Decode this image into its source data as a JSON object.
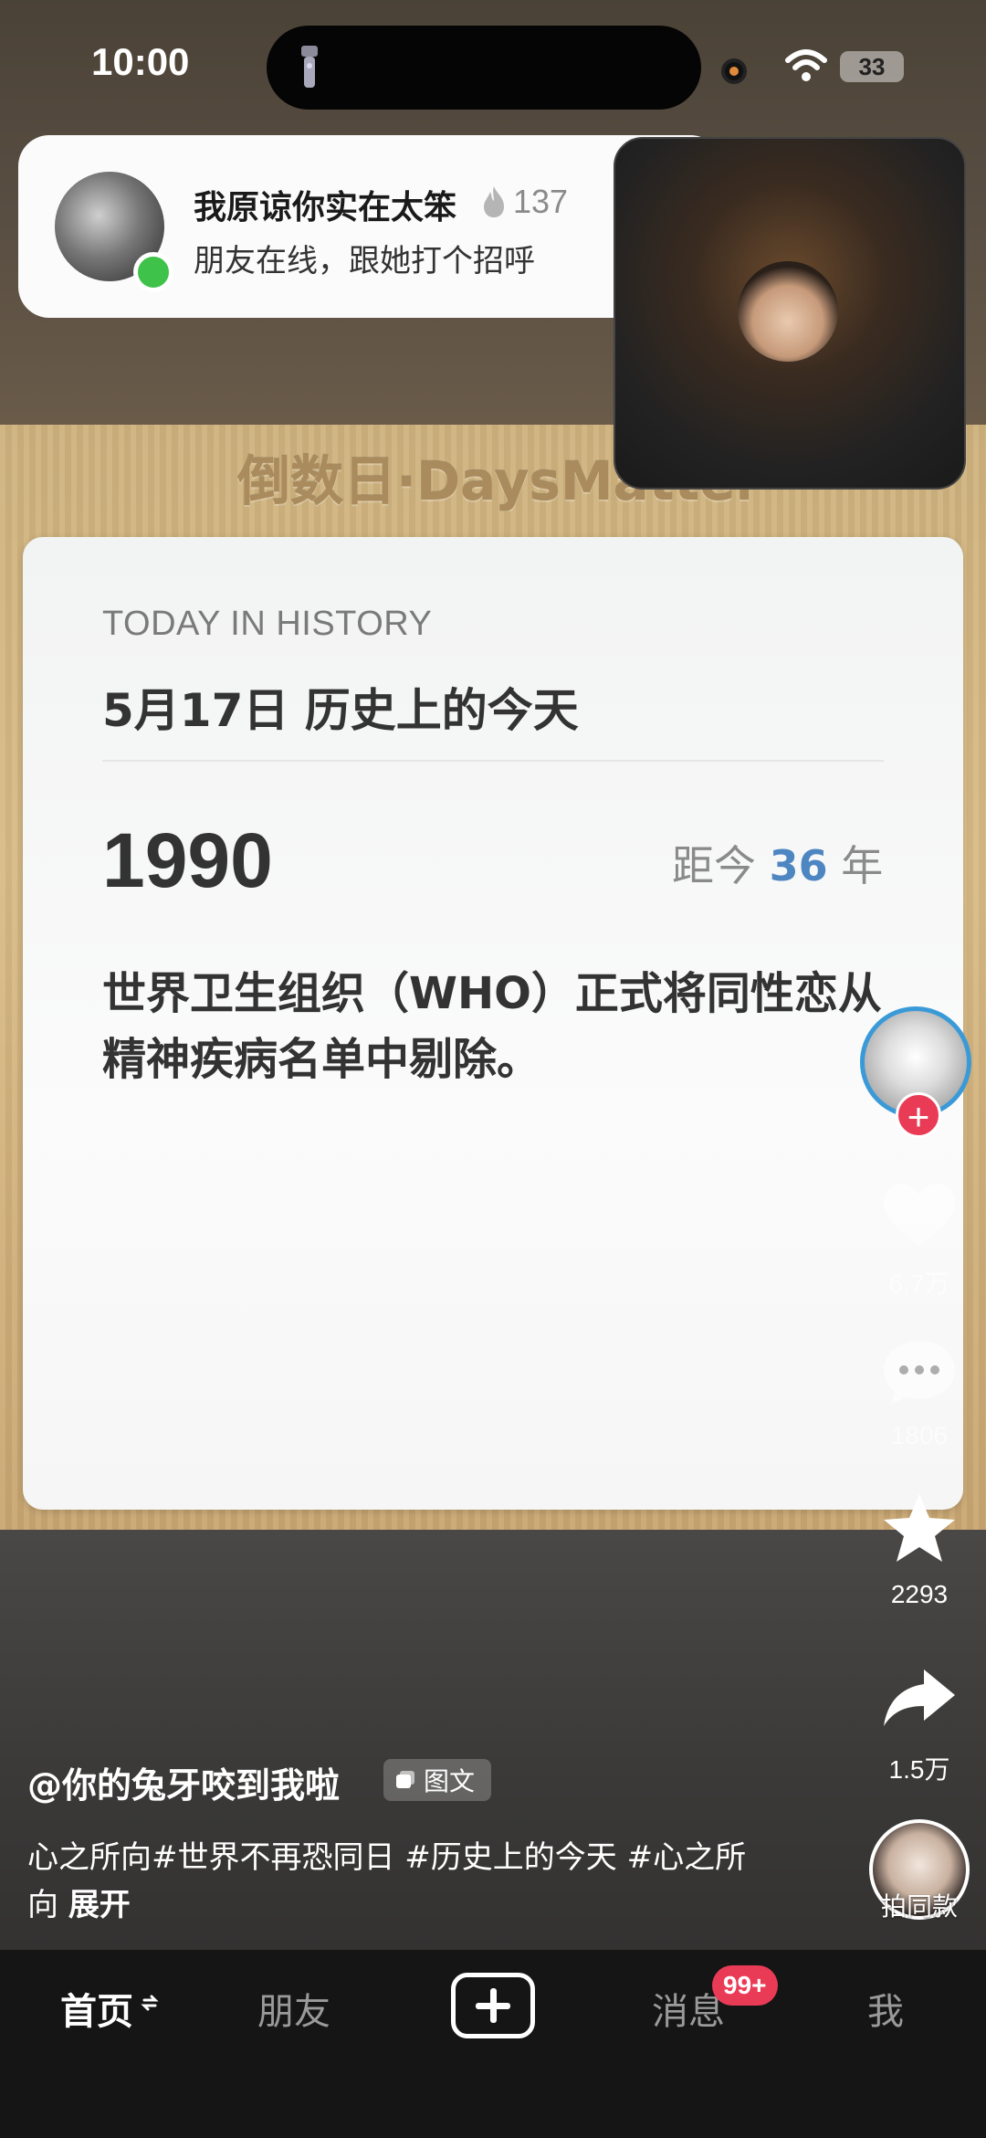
{
  "status_bar": {
    "time": "10:00",
    "battery": "33"
  },
  "notification": {
    "name": "我原谅你实在太笨",
    "streak_count": "137",
    "message": "朋友在线，跟她打个招呼"
  },
  "background": {
    "wood_title": "倒数日·DaysMatter"
  },
  "card": {
    "subtitle": "TODAY IN HISTORY",
    "title": "5月17日  历史上的今天",
    "year": "1990",
    "ago_prefix": "距今",
    "ago_number": "36",
    "ago_suffix": "年",
    "event": "世界卫生组织（WHO）正式将同性恋从精神疾病名单中剔除。"
  },
  "rail": {
    "likes": "6.7万",
    "comments": "1806",
    "favorites": "2293",
    "shares": "1.5万",
    "same_style_label": "拍同款",
    "follow_symbol": "+"
  },
  "caption": {
    "author": "@你的兔牙咬到我啦",
    "type_tag": "图文",
    "description": "心之所向#世界不再恐同日 #历史上的今天 #心之所向",
    "expand": "展开"
  },
  "tabbar": {
    "home": "首页",
    "friends": "朋友",
    "messages": "消息",
    "messages_badge": "99+",
    "me": "我"
  },
  "colors": {
    "accent_blue": "#4e86c1",
    "badge_red": "#ea3b56",
    "online_green": "#3fc24a"
  }
}
